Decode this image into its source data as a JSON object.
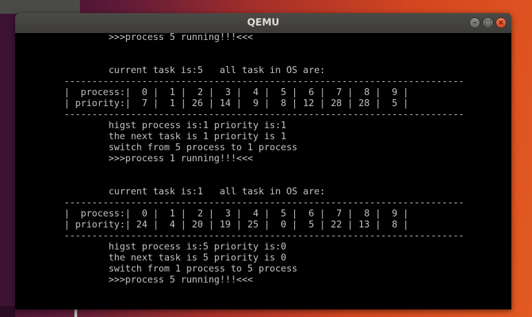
{
  "window": {
    "title": "QEMU"
  },
  "console": {
    "lines": [
      "        >>>process 5 running!!!<<<",
      "",
      "",
      "        current task is:5   all task in OS are:",
      "------------------------------------------------------------------------",
      "|  process:|  0 |  1 |  2 |  3 |  4 |  5 |  6 |  7 |  8 |  9 |",
      "| priority:|  7 |  1 | 26 | 14 |  9 |  8 | 12 | 28 | 28 |  5 |",
      "------------------------------------------------------------------------",
      "        higst process is:1 priority is:1",
      "        the next task is 1 priority is 1",
      "        switch from 5 process to 1 process",
      "        >>>process 1 running!!!<<<",
      "",
      "",
      "        current task is:1   all task in OS are:",
      "------------------------------------------------------------------------",
      "|  process:|  0 |  1 |  2 |  3 |  4 |  5 |  6 |  7 |  8 |  9 |",
      "| priority:| 24 |  4 | 20 | 19 | 25 |  0 |  5 | 22 | 13 |  8 |",
      "------------------------------------------------------------------------",
      "        higst process is:5 priority is:0",
      "        the next task is 5 priority is 0",
      "        switch from 1 process to 5 process",
      "        >>>process 5 running!!!<<<"
    ]
  }
}
